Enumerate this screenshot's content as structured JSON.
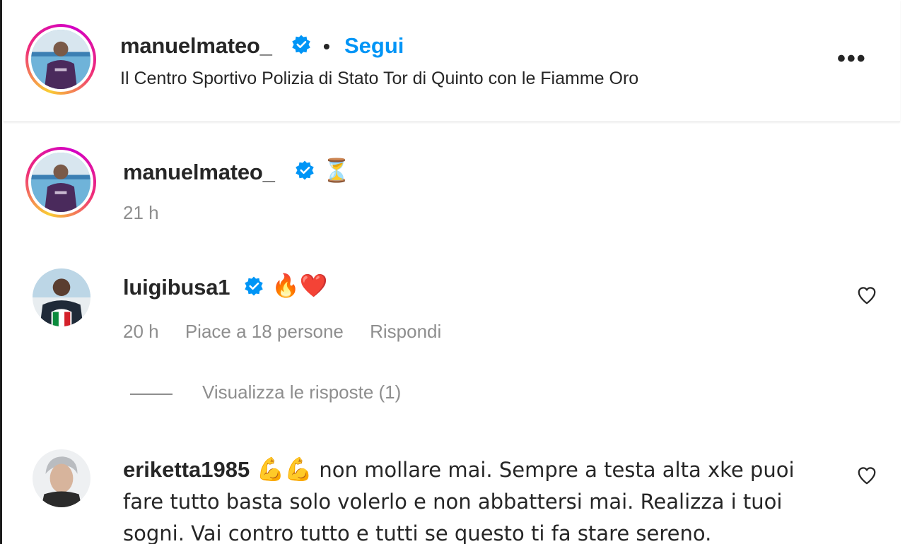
{
  "post": {
    "author": "manuelmateo_",
    "separator": "•",
    "follow_label": "Segui",
    "location": "Il Centro Sportivo Polizia di Stato Tor di Quinto con le Fiamme Oro",
    "more_label": "•••"
  },
  "caption": {
    "author": "manuelmateo_",
    "emoji": "⏳",
    "time": "21 h"
  },
  "comments": [
    {
      "author": "luigibusa1",
      "emoji": "🔥❤️",
      "time": "20 h",
      "likes": "Piace a 18 persone",
      "reply_label": "Rispondi",
      "view_replies": "Visualizza le risposte (1)"
    },
    {
      "author": "eriketta1985",
      "emoji": "💪💪",
      "text": "non mollare mai. Sempre a testa alta xke puoi fare tutto basta solo volerlo e non abbattersi mai. Realizza i tuoi sogni. Vai contro tutto e tutti se questo ti fa stare sereno."
    }
  ],
  "colors": {
    "link": "#0095f6",
    "verified": "#0095f6",
    "muted": "#8e8e8e",
    "text": "#262626"
  }
}
